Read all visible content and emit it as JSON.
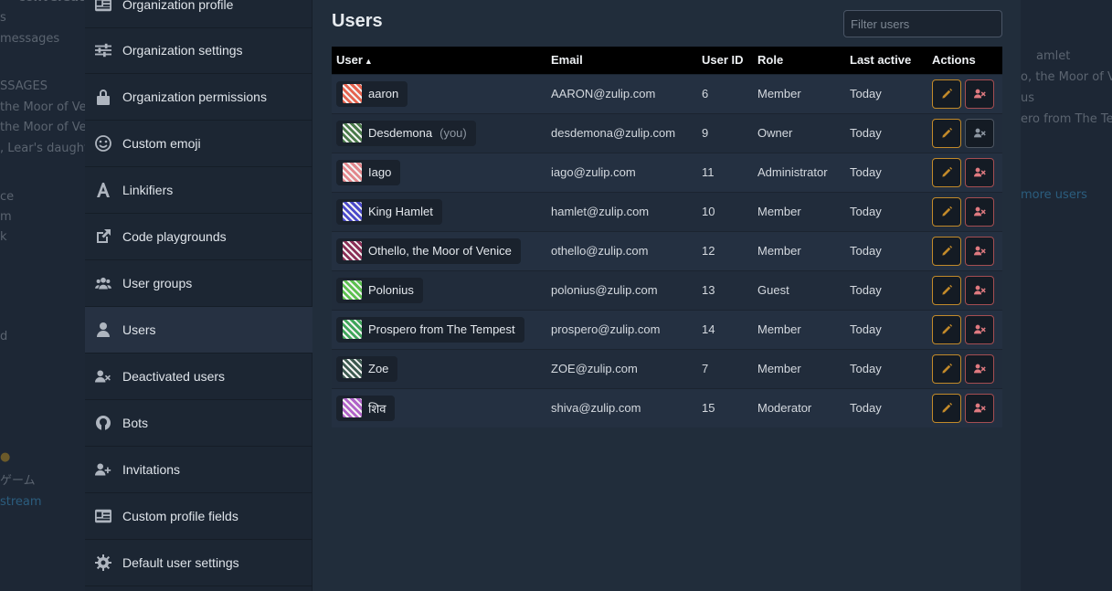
{
  "background_left": {
    "texts": [
      "conversations",
      "s",
      "messages",
      "SSAGES",
      " the Moor of Venic",
      " the Moor of Veni",
      ", Lear's daughte",
      "ce",
      "m",
      "k",
      "d",
      "ゲーム"
    ],
    "link": " stream"
  },
  "background_right": {
    "texts": [
      "amlet",
      "o, the Moor of Veni",
      "us",
      "ero from The Temp"
    ],
    "link": "more users"
  },
  "sidebar": {
    "items": [
      {
        "label": "Organization profile",
        "icon": "id-card-icon"
      },
      {
        "label": "Organization settings",
        "icon": "sliders-icon"
      },
      {
        "label": "Organization permissions",
        "icon": "lock-icon"
      },
      {
        "label": "Custom emoji",
        "icon": "smile-icon"
      },
      {
        "label": "Linkifiers",
        "icon": "font-a-icon"
      },
      {
        "label": "Code playgrounds",
        "icon": "external-link-icon"
      },
      {
        "label": "User groups",
        "icon": "users-icon"
      },
      {
        "label": "Users",
        "icon": "user-icon",
        "active": true
      },
      {
        "label": "Deactivated users",
        "icon": "user-times-icon"
      },
      {
        "label": "Bots",
        "icon": "github-icon"
      },
      {
        "label": "Invitations",
        "icon": "user-plus-icon"
      },
      {
        "label": "Custom profile fields",
        "icon": "id-card-icon"
      },
      {
        "label": "Default user settings",
        "icon": "gear-icon"
      }
    ]
  },
  "main": {
    "title": "Users",
    "filter_placeholder": "Filter users",
    "columns": [
      "User",
      "Email",
      "User ID",
      "Role",
      "Last active",
      "Actions"
    ],
    "sort_indicator": "▲",
    "you_label": "(you)",
    "rows": [
      {
        "name": "aaron",
        "email": "AARON@zulip.com",
        "user_id": "6",
        "role": "Member",
        "last_active": "Today",
        "avatar_color": "#e5634f",
        "deactivate_enabled": true
      },
      {
        "name": "Desdemona",
        "you": true,
        "email": "desdemona@zulip.com",
        "user_id": "9",
        "role": "Owner",
        "last_active": "Today",
        "avatar_color": "#4a7a4a",
        "deactivate_enabled": false
      },
      {
        "name": "Iago",
        "email": "iago@zulip.com",
        "user_id": "11",
        "role": "Administrator",
        "last_active": "Today",
        "avatar_color": "#e2878c",
        "deactivate_enabled": true
      },
      {
        "name": "King Hamlet",
        "email": "hamlet@zulip.com",
        "user_id": "10",
        "role": "Member",
        "last_active": "Today",
        "avatar_color": "#4b4ac9",
        "deactivate_enabled": true
      },
      {
        "name": "Othello, the Moor of Venice",
        "email": "othello@zulip.com",
        "user_id": "12",
        "role": "Member",
        "last_active": "Today",
        "avatar_color": "#8a2f56",
        "deactivate_enabled": true
      },
      {
        "name": "Polonius",
        "email": "polonius@zulip.com",
        "user_id": "13",
        "role": "Guest",
        "last_active": "Today",
        "avatar_color": "#5cc04f",
        "deactivate_enabled": true
      },
      {
        "name": "Prospero from The Tempest",
        "email": "prospero@zulip.com",
        "user_id": "14",
        "role": "Member",
        "last_active": "Today",
        "avatar_color": "#3fa55a",
        "deactivate_enabled": true
      },
      {
        "name": "Zoe",
        "email": "ZOE@zulip.com",
        "user_id": "7",
        "role": "Member",
        "last_active": "Today",
        "avatar_color": "#3d5a50",
        "deactivate_enabled": true
      },
      {
        "name": "शिव",
        "email": "shiva@zulip.com",
        "user_id": "15",
        "role": "Moderator",
        "last_active": "Today",
        "avatar_color": "#b063c8",
        "deactivate_enabled": true
      }
    ]
  },
  "colors": {
    "edit_accent": "#c28a2a",
    "deactivate_accent": "#e07a80",
    "header_bg": "#000000"
  }
}
